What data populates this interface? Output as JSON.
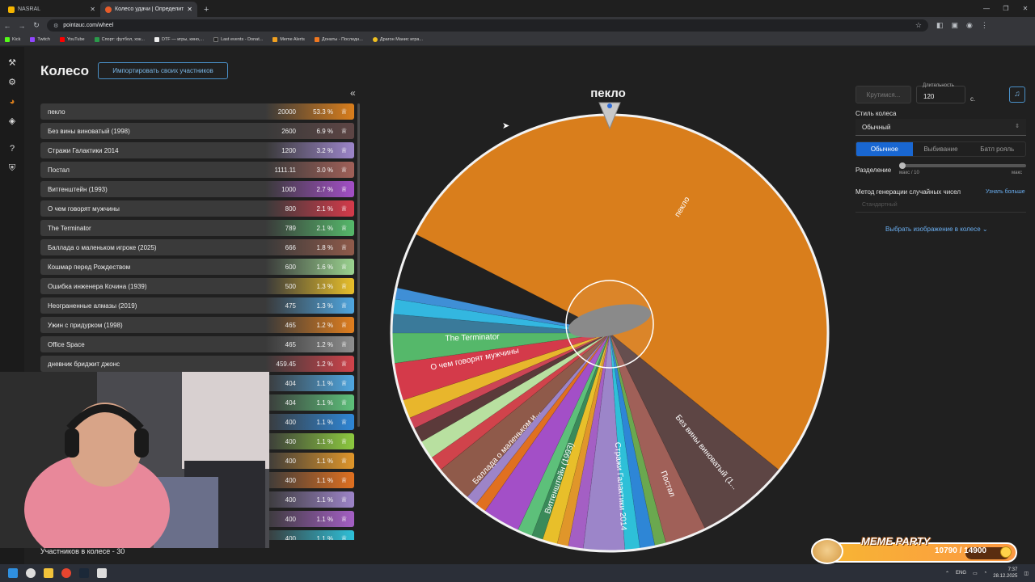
{
  "browser": {
    "tabs": [
      {
        "label": "NASRAL",
        "active": false
      },
      {
        "label": "Колесо удачи | Определите по",
        "active": true
      }
    ],
    "new_tab": "+",
    "url": "pointauc.com/wheel",
    "bookmarks": [
      "Kick",
      "Twitch",
      "YouTube",
      "Спорт: футбол, хок...",
      "DTF — игры, кино,...",
      "Last events - Donat...",
      "Meme Alerts",
      "Донаты - Последн...",
      "Драгон Манис игра..."
    ]
  },
  "page": {
    "title": "Колесо",
    "import_button": "Импортировать своих участников",
    "collapse_icon": "«",
    "participants_count": "Участников в колесе - 30"
  },
  "participants": [
    {
      "name": "пекло",
      "amount": "20000",
      "percent": "53.3 %",
      "color": "#d97e1c"
    },
    {
      "name": "Без вины виноватый (1998)",
      "amount": "2600",
      "percent": "6.9 %",
      "color": "#5d4544"
    },
    {
      "name": "Стражи Галактики 2014",
      "amount": "1200",
      "percent": "3.2 %",
      "color": "#9c85c9"
    },
    {
      "name": "Постал",
      "amount": "1111.11",
      "percent": "3.0 %",
      "color": "#a06058"
    },
    {
      "name": "Витгенштейн (1993)",
      "amount": "1000",
      "percent": "2.7 %",
      "color": "#a34fc7"
    },
    {
      "name": "О чем говорят мужчины",
      "amount": "800",
      "percent": "2.1 %",
      "color": "#d43a4a"
    },
    {
      "name": "The Terminator",
      "amount": "789",
      "percent": "2.1 %",
      "color": "#55b86a"
    },
    {
      "name": "Баллада о маленьком игроке (2025)",
      "amount": "666",
      "percent": "1.8 %",
      "color": "#8f5a4a"
    },
    {
      "name": "Кошмар перед Рождеством",
      "amount": "600",
      "percent": "1.6 %",
      "color": "#9ad28f"
    },
    {
      "name": "Ошибка инженера Кочина (1939)",
      "amount": "500",
      "percent": "1.3 %",
      "color": "#e8bf2a"
    },
    {
      "name": "Неограненные алмазы (2019)",
      "amount": "475",
      "percent": "1.3 %",
      "color": "#4fa6e0"
    },
    {
      "name": "Ужин с придурком (1998)",
      "amount": "465",
      "percent": "1.2 %",
      "color": "#e07e1e"
    },
    {
      "name": "Office Space",
      "amount": "465",
      "percent": "1.2 %",
      "color": "#8e8e8e"
    },
    {
      "name": "дневник бриджит джонс",
      "amount": "459.45",
      "percent": "1.2 %",
      "color": "#d0434b"
    },
    {
      "name": "",
      "amount": "404",
      "percent": "1.1 %",
      "color": "#4fa6e0"
    },
    {
      "name": "",
      "amount": "404",
      "percent": "1.1 %",
      "color": "#5dc07a"
    },
    {
      "name": "",
      "amount": "400",
      "percent": "1.1 %",
      "color": "#2e86d6"
    },
    {
      "name": "",
      "amount": "400",
      "percent": "1.1 %",
      "color": "#8cc93f"
    },
    {
      "name": "",
      "amount": "400",
      "percent": "1.1 %",
      "color": "#e0962a"
    },
    {
      "name": "",
      "amount": "400",
      "percent": "1.1 %",
      "color": "#e07020"
    },
    {
      "name": "",
      "amount": "400",
      "percent": "1.1 %",
      "color": "#9d84c8"
    },
    {
      "name": "",
      "amount": "400",
      "percent": "1.1 %",
      "color": "#a45fc4"
    },
    {
      "name": "",
      "amount": "400",
      "percent": "1.1 %",
      "color": "#2ec0d8"
    }
  ],
  "wheel": {
    "winner": "пекло",
    "slice_labels": [
      "пекло",
      "Без вины виноватый (1...",
      "Постал",
      "Стражи Галактики 2014",
      "Витгенштейн (1993)",
      "Баллада о маленьком и...",
      "О чем говорят мужчины",
      "The Terminator"
    ],
    "extra_slice_colors": [
      "#3f8fd6",
      "#33b7e0",
      "#3a7a9a",
      "#b05c8a",
      "#e8b62c",
      "#3a8a5a",
      "#7a5fb8",
      "#cc4455",
      "#5b3a3a",
      "#b8e0a0",
      "#444444",
      "#e0a030",
      "#2d5a3a",
      "#c2a0e0",
      "#e06030",
      "#70c0e0"
    ]
  },
  "controls": {
    "spin_button": "Крутимся...",
    "duration_label": "Длительность",
    "duration_value": "120",
    "duration_unit": "с.",
    "music_icon": "music-icon",
    "wheel_style_label": "Стиль колеса",
    "wheel_style_value": "Обычный",
    "modes": [
      "Обычное",
      "Выбивание",
      "Батл рояль"
    ],
    "split_label": "Разделение",
    "split_min": "макс / 10",
    "split_max": "макс",
    "rng_label": "Метод генерации случайных чисел",
    "rng_link": "Узнать больше",
    "rng_value": "Стандартный",
    "image_picker": "Выбрать изображение в колесе"
  },
  "meme_overlay": {
    "title": "MEME PARTY",
    "progress_text": "10790 / 14900",
    "progress_fraction": 0.724
  },
  "taskbar": {
    "lang": "ENG",
    "time": "7:37",
    "date": "28.12.2025"
  }
}
